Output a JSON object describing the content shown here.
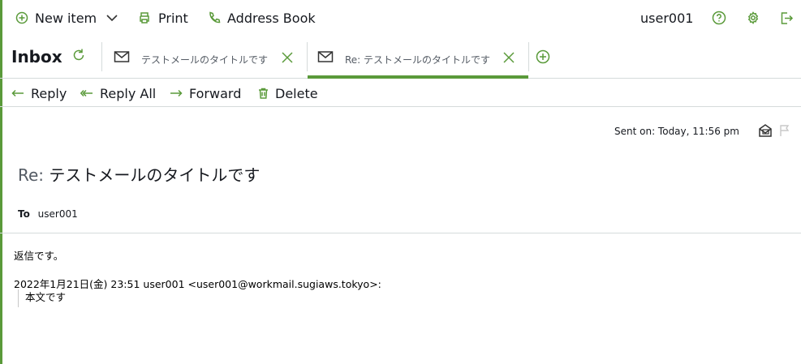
{
  "topbar": {
    "new_item": "New item",
    "print": "Print",
    "address_book": "Address Book",
    "username": "user001"
  },
  "tabs_row": {
    "inbox": "Inbox",
    "tabs": [
      {
        "title": "テストメールのタイトルです",
        "active": false
      },
      {
        "title": "Re: テストメールのタイトルです",
        "active": true
      }
    ]
  },
  "actions": {
    "reply": "Reply",
    "reply_all": "Reply All",
    "forward": "Forward",
    "delete": "Delete"
  },
  "message": {
    "sent_on": "Sent on: Today, 11:56 pm",
    "subject_prefix": "Re:",
    "subject_title": "テストメールのタイトルです",
    "to_label": "To",
    "to_value": "user001",
    "body_line": "返信です。",
    "quote_header": "2022年1月21日(金) 23:51 user001 <user001@workmail.sugiaws.tokyo>:",
    "quote_text": "本文です"
  },
  "colors": {
    "accent": "#5a9a3a",
    "border": "#d5dbdb",
    "text": "#16191f",
    "muted": "#545b64"
  }
}
